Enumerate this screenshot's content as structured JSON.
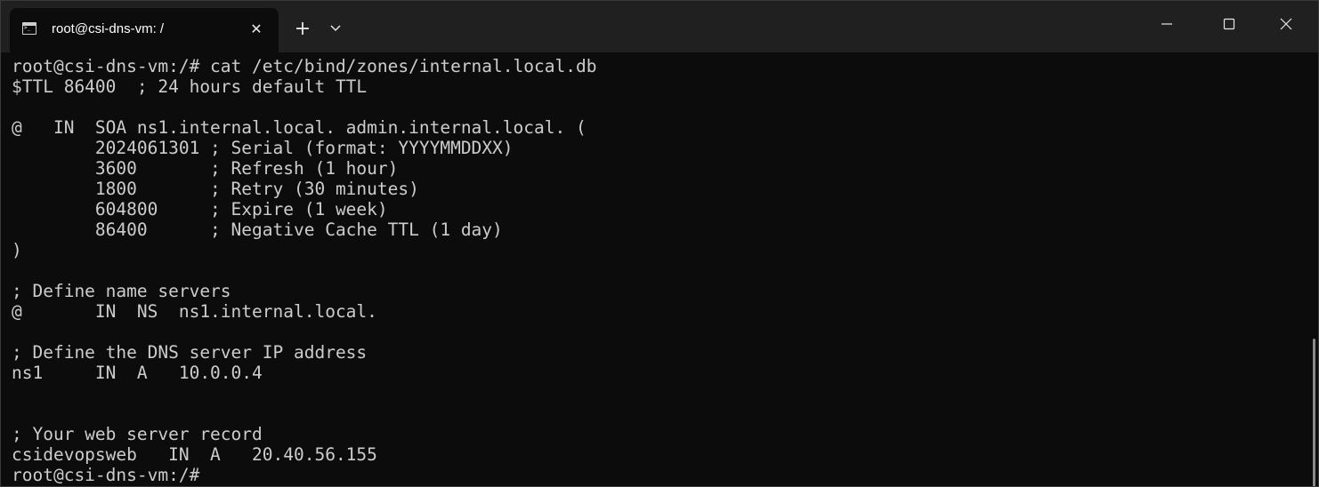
{
  "window": {
    "tab_title": "root@csi-dns-vm: /",
    "tab_close_glyph": "✕",
    "new_tab_glyph": "+"
  },
  "terminal": {
    "lines": [
      "root@csi-dns-vm:/# cat /etc/bind/zones/internal.local.db",
      "$TTL 86400  ; 24 hours default TTL",
      "",
      "@   IN  SOA ns1.internal.local. admin.internal.local. (",
      "        2024061301 ; Serial (format: YYYYMMDDXX)",
      "        3600       ; Refresh (1 hour)",
      "        1800       ; Retry (30 minutes)",
      "        604800     ; Expire (1 week)",
      "        86400      ; Negative Cache TTL (1 day)",
      ")",
      "",
      "; Define name servers",
      "@       IN  NS  ns1.internal.local.",
      "",
      "; Define the DNS server IP address",
      "ns1     IN  A   10.0.0.4",
      "",
      "",
      "; Your web server record",
      "csidevopsweb   IN  A   20.40.56.155",
      "root@csi-dns-vm:/#"
    ]
  },
  "colors": {
    "background": "#0c0c0c",
    "titlebar": "#202020",
    "text": "#cccccc"
  }
}
